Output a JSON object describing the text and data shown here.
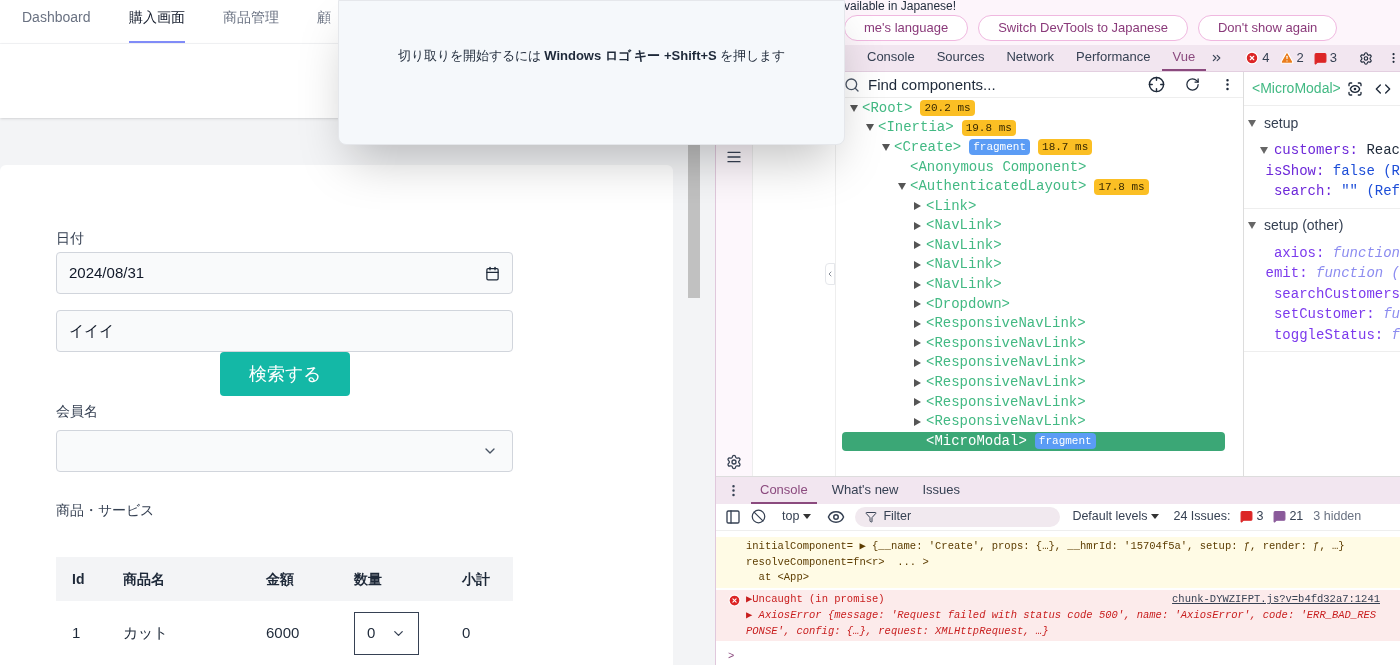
{
  "app": {
    "nav_tabs": [
      {
        "label": "Dashboard",
        "selected": false
      },
      {
        "label": "購入画面",
        "selected": true
      },
      {
        "label": "商品管理",
        "selected": false
      },
      {
        "label": "顧",
        "selected": false
      }
    ],
    "form": {
      "date_label": "日付",
      "date_value": "2024/08/31",
      "search_value": "イイイ",
      "search_button": "検索する",
      "member_label": "会員名",
      "items_label": "商品・サービス"
    },
    "table": {
      "columns": [
        "Id",
        "商品名",
        "金額",
        "数量",
        "小計"
      ],
      "rows": [
        {
          "id": "1",
          "name": "カット",
          "price": "6000",
          "quantity": "0",
          "subtotal": "0"
        }
      ]
    }
  },
  "snip_popup": {
    "message": "切り取りを開始するには **Windows ロゴ キー +Shift+S** を押します"
  },
  "devtools": {
    "banner": {
      "text": "vailable in Japanese!",
      "buttons": [
        "me's language",
        "Switch DevTools to Japanese",
        "Don't show again"
      ]
    },
    "tabs": [
      {
        "label": "Console",
        "selected": false
      },
      {
        "label": "Sources",
        "selected": false
      },
      {
        "label": "Network",
        "selected": false
      },
      {
        "label": "Performance",
        "selected": false
      },
      {
        "label": "Vue",
        "selected": true
      }
    ],
    "counters": [
      {
        "kind": "error",
        "count": "4"
      },
      {
        "kind": "warning",
        "count": "2"
      },
      {
        "kind": "issue",
        "count": "3"
      }
    ],
    "search_placeholder": "Find components...",
    "tree": [
      {
        "label": "<Root>",
        "expanded": true,
        "selected": false,
        "badges": [
          {
            "kind": "time",
            "text": "20.2 ms"
          }
        ],
        "children": [
          {
            "label": "<Inertia>",
            "expanded": true,
            "selected": false,
            "badges": [
              {
                "kind": "time",
                "text": "19.8 ms"
              }
            ],
            "children": [
              {
                "label": "<Create>",
                "expanded": true,
                "selected": false,
                "badges": [
                  {
                    "kind": "fragment",
                    "text": "fragment"
                  },
                  {
                    "kind": "time",
                    "text": "18.7 ms"
                  }
                ],
                "children": [
                  {
                    "label": "<Anonymous Component>",
                    "selected": false
                  },
                  {
                    "label": "<AuthenticatedLayout>",
                    "expanded": true,
                    "selected": false,
                    "badges": [
                      {
                        "kind": "time",
                        "text": "17.8 ms"
                      }
                    ],
                    "children": [
                      {
                        "label": "<Link>",
                        "expanded": false,
                        "selected": false
                      },
                      {
                        "label": "<NavLink>",
                        "expanded": false,
                        "selected": false
                      },
                      {
                        "label": "<NavLink>",
                        "expanded": false,
                        "selected": false
                      },
                      {
                        "label": "<NavLink>",
                        "expanded": false,
                        "selected": false
                      },
                      {
                        "label": "<NavLink>",
                        "expanded": false,
                        "selected": false
                      },
                      {
                        "label": "<Dropdown>",
                        "expanded": false,
                        "selected": false
                      },
                      {
                        "label": "<ResponsiveNavLink>",
                        "expanded": false,
                        "selected": false
                      },
                      {
                        "label": "<ResponsiveNavLink>",
                        "expanded": false,
                        "selected": false
                      },
                      {
                        "label": "<ResponsiveNavLink>",
                        "expanded": false,
                        "selected": false
                      },
                      {
                        "label": "<ResponsiveNavLink>",
                        "expanded": false,
                        "selected": false
                      },
                      {
                        "label": "<ResponsiveNavLink>",
                        "expanded": false,
                        "selected": false
                      },
                      {
                        "label": "<ResponsiveNavLink>",
                        "expanded": false,
                        "selected": false
                      },
                      {
                        "label": "<MicroModal>",
                        "selected": true,
                        "badges": [
                          {
                            "kind": "fragment",
                            "text": "fragment"
                          }
                        ]
                      }
                    ]
                  }
                ]
              }
            ]
          }
        ]
      }
    ],
    "inspector": {
      "title": "<MicroModal>",
      "sections": [
        {
          "title": "setup",
          "props": [
            {
              "key": "customers:",
              "value": "Reac",
              "kind": "object",
              "expanded": true
            },
            {
              "key": "isShow:",
              "value": "false (R",
              "kind": "value"
            },
            {
              "key": "search:",
              "value": "\"\" (Ref",
              "kind": "value"
            }
          ]
        },
        {
          "title": "setup (other)",
          "props": [
            {
              "key": "axios:",
              "value": "function",
              "kind": "function"
            },
            {
              "key": "emit:",
              "value": "function (",
              "kind": "function"
            },
            {
              "key": "searchCustomers",
              "kind": "function"
            },
            {
              "key": "setCustomer:",
              "value": "fu",
              "kind": "function"
            },
            {
              "key": "toggleStatus:",
              "value": "f",
              "kind": "function"
            }
          ]
        }
      ]
    },
    "drawer_tabs": [
      {
        "label": "Console",
        "selected": true
      },
      {
        "label": "What's new",
        "selected": false
      },
      {
        "label": "Issues",
        "selected": false
      }
    ],
    "console_toolbar": {
      "context": "top",
      "filter_placeholder": "Filter",
      "levels": "Default levels",
      "issues_label": "24 Issues:",
      "issue_counts": [
        {
          "kind": "issue",
          "count": "3"
        },
        {
          "kind": "info",
          "count": "21"
        }
      ],
      "hidden": "3 hidden"
    },
    "messages": [
      {
        "kind": "warning",
        "lines": [
          "initialComponent= ▶ {__name: 'Create', props: {…}, __hmrId: '15704f5a', setup: ƒ, render: ƒ, …}",
          "resolveComponent=fn<r>  ... >",
          "  at <App>"
        ]
      },
      {
        "kind": "error",
        "lines": [
          "▶Uncaught (in promise)",
          "▶ AxiosError {message: 'Request failed with status code 500', name: 'AxiosError', code: 'ERR_BAD_RESPONSE', config: {…}, request: XMLHttpRequest, …}"
        ],
        "source": "chunk-DYWZIFPT.js?v=b4fd32a7:1241"
      }
    ],
    "prompt": ">"
  }
}
